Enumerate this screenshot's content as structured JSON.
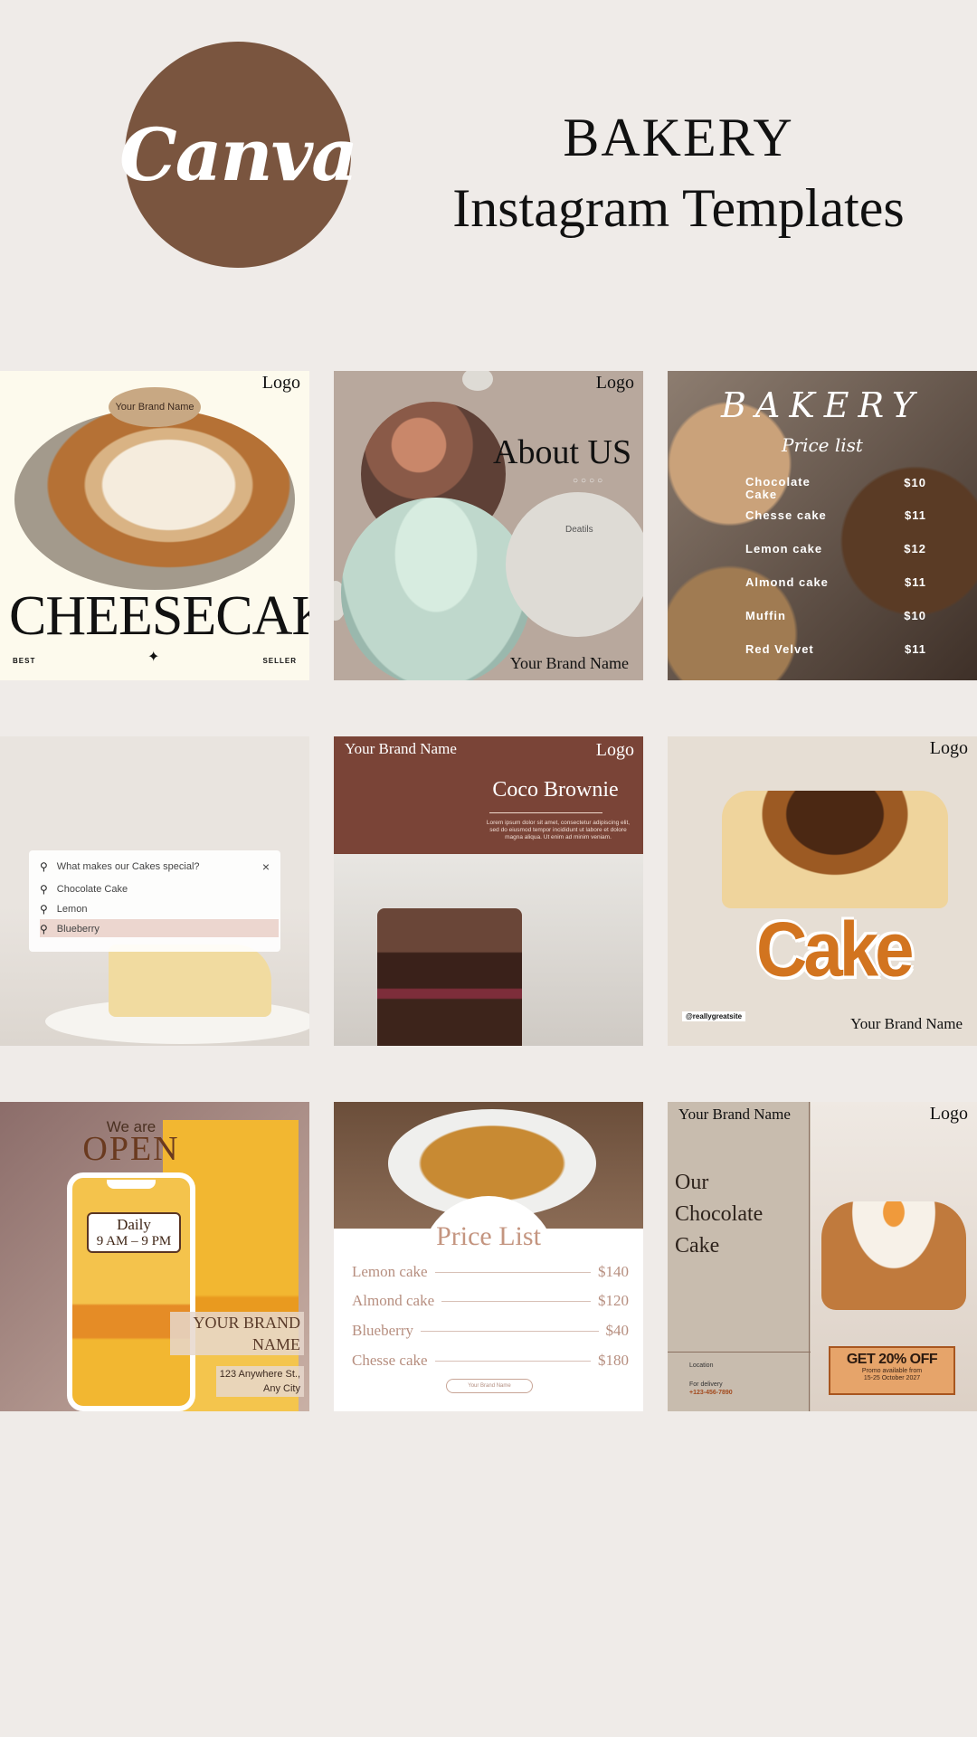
{
  "header": {
    "logo_text": "Canva",
    "title": "BAKERY",
    "subtitle": "Instagram Templates"
  },
  "tiles": {
    "t1": {
      "logo": "Logo",
      "brand": "Your Brand Name",
      "headline": "CHEESECAKE",
      "left_tag": "BEST",
      "right_tag": "SELLER",
      "star": "✦"
    },
    "t2": {
      "logo": "Logo",
      "headline": "About US",
      "dots": "○○○○",
      "details": "Deatils",
      "brand": "Your Brand Name"
    },
    "t3": {
      "title": "BAKERY",
      "subtitle": "Price list",
      "items": [
        {
          "name": "Chocolate Cake",
          "price": "$10"
        },
        {
          "name": "Chesse cake",
          "price": "$11"
        },
        {
          "name": "Lemon cake",
          "price": "$12"
        },
        {
          "name": "Almond cake",
          "price": "$11"
        },
        {
          "name": "Muffin",
          "price": "$10"
        },
        {
          "name": "Red Velvet",
          "price": "$11"
        }
      ]
    },
    "t4": {
      "search_query": "What makes our Cakes special?",
      "close": "×",
      "suggestions": [
        "Chocolate Cake",
        "Lemon",
        "Blueberry"
      ]
    },
    "t5": {
      "brand": "Your Brand Name",
      "logo": "Logo",
      "name": "Coco Brownie",
      "lorem": "Lorem ipsum dolor sit amet, consectetur adipiscing elit, sed do eiusmod tempor incididunt ut labore et dolore magna aliqua. Ut enim ad minim veniam."
    },
    "t6": {
      "logo": "Logo",
      "word": "Cake",
      "site": "@reallygreatsite",
      "brand": "Your Brand Name"
    },
    "t7": {
      "we_are": "We are",
      "open": "OPEN",
      "days": "Daily",
      "hours": "9 AM – 9 PM",
      "brand": "YOUR BRAND NAME",
      "address_1": "123 Anywhere St.,",
      "address_2": "Any City"
    },
    "t8": {
      "title": "Price List",
      "items": [
        {
          "name": "Lemon cake",
          "price": "$140"
        },
        {
          "name": "Almond cake",
          "price": "$120"
        },
        {
          "name": "Blueberry",
          "price": "$40"
        },
        {
          "name": "Chesse cake",
          "price": "$180"
        }
      ],
      "button": "Your Brand Name"
    },
    "t9": {
      "brand": "Your Brand Name",
      "logo": "Logo",
      "heading_1": "Our",
      "heading_2": "Chocolate",
      "heading_3": "Cake",
      "location": "Location",
      "delivery": "For delivery",
      "phone": "+123-456-7890",
      "promo": "GET 20% OFF",
      "promo_sub_1": "Promo available from",
      "promo_sub_2": "15-25 October 2027"
    }
  }
}
